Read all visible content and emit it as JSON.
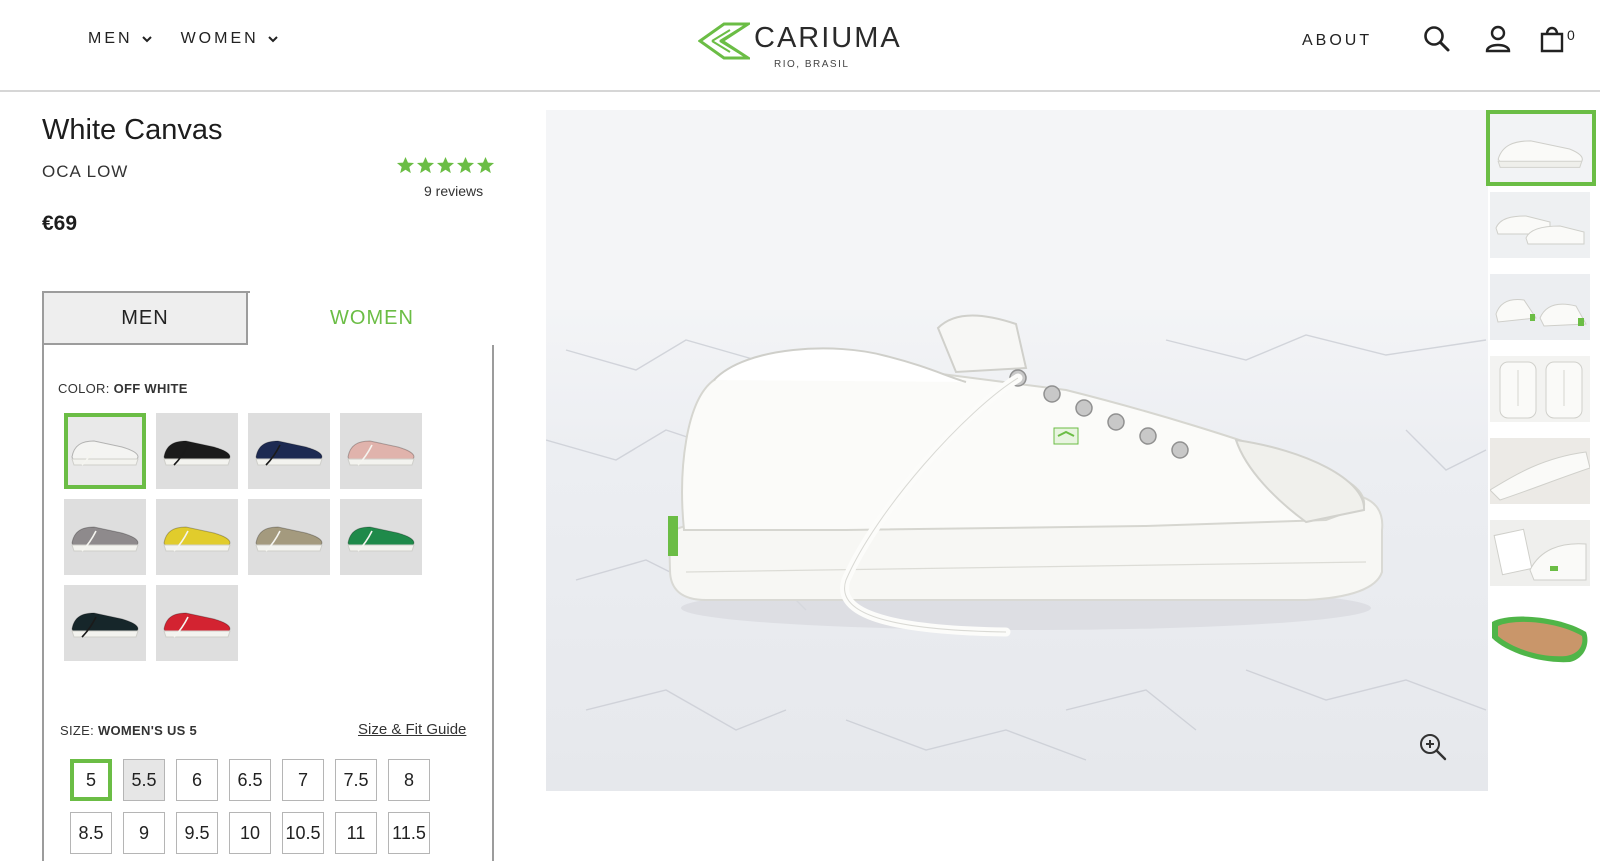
{
  "header": {
    "nav_left": [
      {
        "label": "MEN"
      },
      {
        "label": "WOMEN"
      }
    ],
    "logo_text": "CARIUMA",
    "logo_sub": "RIO, BRASIL",
    "about_label": "ABOUT",
    "cart_count": "0",
    "icons": [
      "search-icon",
      "user-icon",
      "bag-icon",
      "chevron-down-icon"
    ]
  },
  "product": {
    "name": "White Canvas",
    "model": "OCA LOW",
    "rating_stars": 5,
    "reviews_text": "9 reviews",
    "price": "€69"
  },
  "selector": {
    "tabs": [
      {
        "label": "MEN",
        "active": false
      },
      {
        "label": "WOMEN",
        "active": true
      }
    ],
    "color_label_prefix": "COLOR:",
    "color_value": "OFF WHITE",
    "swatches": [
      {
        "color": "#f4f4f2",
        "selected": true
      },
      {
        "color": "#1b1b1b",
        "selected": false
      },
      {
        "color": "#1d2a52",
        "selected": false
      },
      {
        "color": "#e0b3ac",
        "selected": false
      },
      {
        "color": "#8e8a8c",
        "selected": false
      },
      {
        "color": "#e1cc2c",
        "selected": false
      },
      {
        "color": "#a49a7e",
        "selected": false
      },
      {
        "color": "#1f8a4a",
        "selected": false
      },
      {
        "color": "#16262a",
        "selected": false
      },
      {
        "color": "#d32331",
        "selected": false
      }
    ],
    "size_label_prefix": "SIZE:",
    "size_value": "WOMEN'S US 5",
    "fit_guide_label": "Size & Fit Guide",
    "sizes": [
      {
        "label": "5",
        "state": "selected"
      },
      {
        "label": "5.5",
        "state": "disabled"
      },
      {
        "label": "6",
        "state": "available"
      },
      {
        "label": "6.5",
        "state": "available"
      },
      {
        "label": "7",
        "state": "available"
      },
      {
        "label": "7.5",
        "state": "available"
      },
      {
        "label": "8",
        "state": "available"
      },
      {
        "label": "8.5",
        "state": "available"
      },
      {
        "label": "9",
        "state": "available"
      },
      {
        "label": "9.5",
        "state": "available"
      },
      {
        "label": "10",
        "state": "available"
      },
      {
        "label": "10.5",
        "state": "available"
      },
      {
        "label": "11",
        "state": "available"
      },
      {
        "label": "11.5",
        "state": "available"
      }
    ]
  },
  "gallery": {
    "thumbnail_count": 7,
    "selected_index": 0,
    "zoom_icon": "zoom-in-icon"
  },
  "colors": {
    "accent": "#6bbd45",
    "text": "#222222"
  }
}
